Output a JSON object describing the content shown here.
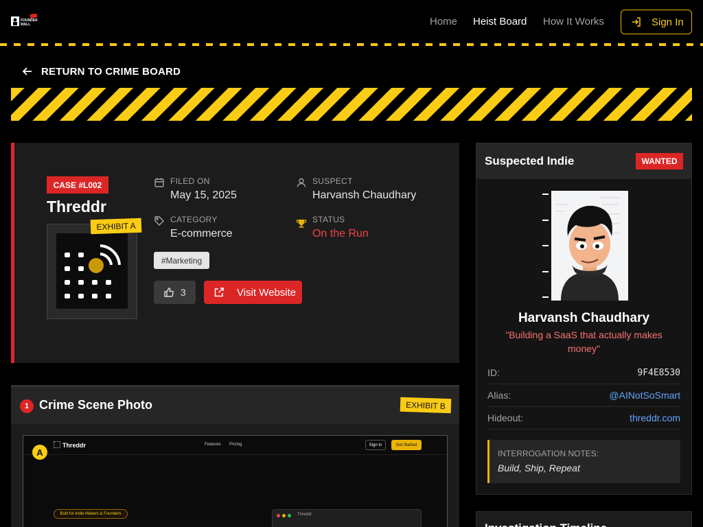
{
  "brand": {
    "logo_text": "FOUNDER WALL"
  },
  "nav": {
    "home": "Home",
    "heist_board": "Heist Board",
    "how_it_works": "How It Works",
    "sign_in": "Sign In"
  },
  "back_link": "RETURN TO CRIME BOARD",
  "case": {
    "badge": "CASE #L002",
    "title": "Threddr",
    "exhibit_label": "EXHIBIT A",
    "filed_on_label": "FILED ON",
    "filed_on": "May 15, 2025",
    "suspect_label": "SUSPECT",
    "suspect": "Harvansh Chaudhary",
    "category_label": "CATEGORY",
    "category": "E-commerce",
    "status_label": "STATUS",
    "status": "On the Run",
    "tag": "#Marketing",
    "likes": "3",
    "visit_label": "Visit Website"
  },
  "crime_scene": {
    "number": "1",
    "title": "Crime Scene Photo",
    "exhibit_label": "EXHIBIT B",
    "marker": "A",
    "preview": {
      "brand": "Threddr",
      "nav_features": "Features",
      "nav_pricing": "Pricing",
      "sign_in": "Sign In",
      "get_started": "Get Started",
      "pill": "Built for Indie Makers & Founders",
      "window_title": "Threddr"
    }
  },
  "suspect_panel": {
    "title": "Suspected Indie",
    "badge": "WANTED",
    "name": "Harvansh Chaudhary",
    "quote": "\"Building a SaaS that actually makes money\"",
    "id_label": "ID:",
    "id_value": "9F4E8530",
    "alias_label": "Alias:",
    "alias_value": "@AINotSoSmart",
    "hideout_label": "Hideout:",
    "hideout_value": "threddr.com",
    "notes_label": "INTERROGATION NOTES:",
    "notes_text": "Build, Ship, Repeat"
  },
  "timeline": {
    "title": "Investigation Timeline"
  },
  "colors": {
    "accent_yellow": "#facc15",
    "accent_red": "#dc2626",
    "link_blue": "#60a5fa"
  }
}
